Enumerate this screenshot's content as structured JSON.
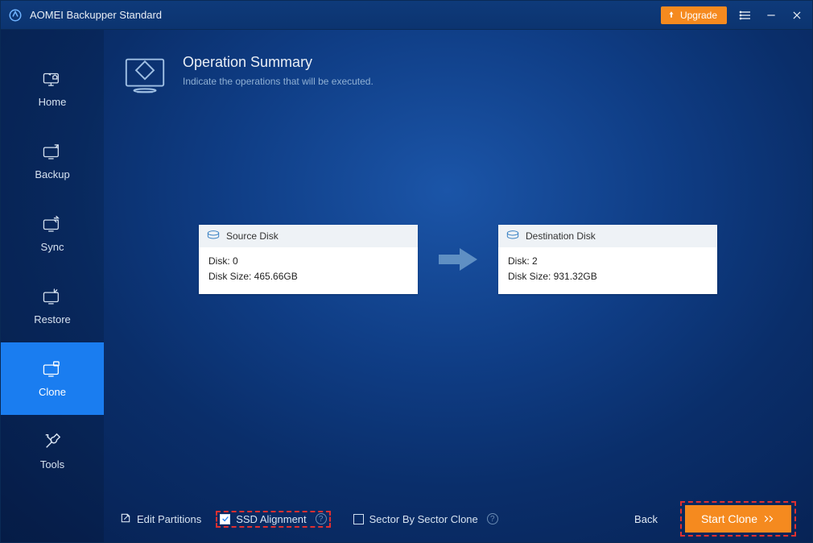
{
  "app": {
    "title": "AOMEI Backupper Standard",
    "upgrade_label": "Upgrade"
  },
  "sidebar": {
    "items": [
      {
        "label": "Home"
      },
      {
        "label": "Backup"
      },
      {
        "label": "Sync"
      },
      {
        "label": "Restore"
      },
      {
        "label": "Clone"
      },
      {
        "label": "Tools"
      }
    ],
    "active_index": 4
  },
  "header": {
    "title": "Operation Summary",
    "subtitle": "Indicate the operations that will be executed."
  },
  "source": {
    "header": "Source Disk",
    "line1": "Disk: 0",
    "line2": "Disk Size: 465.66GB"
  },
  "destination": {
    "header": "Destination Disk",
    "line1": "Disk: 2",
    "line2": "Disk Size: 931.32GB"
  },
  "footer": {
    "edit_partitions": "Edit Partitions",
    "ssd_alignment": "SSD Alignment",
    "ssd_alignment_checked": true,
    "sector_by_sector": "Sector By Sector Clone",
    "sector_by_sector_checked": false,
    "back": "Back",
    "start": "Start Clone"
  }
}
